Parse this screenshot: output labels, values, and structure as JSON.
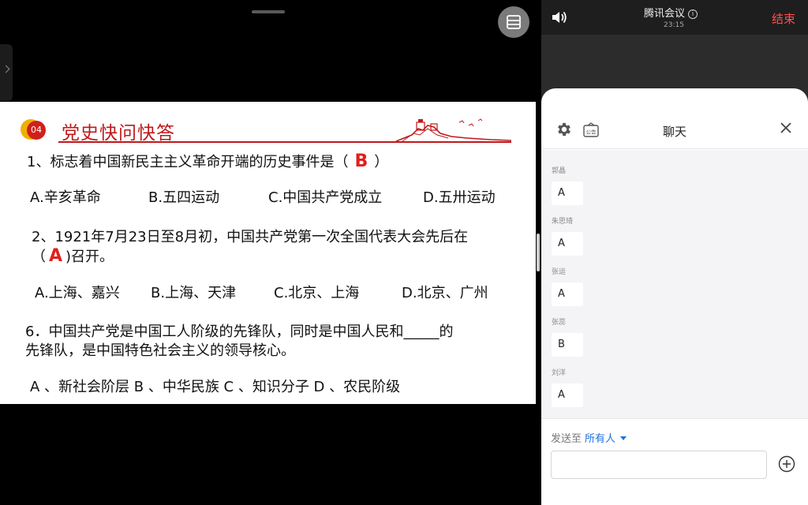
{
  "slide": {
    "badge_number": "04",
    "title": "党史快问快答",
    "q1": {
      "text": "1、标志着中国新民主主义革命开端的历史事件是（",
      "answer": "B",
      "close": "）"
    },
    "q1_options": [
      "A.辛亥革命",
      "B.五四运动",
      "C.中国共产党成立",
      "D.五卅运动"
    ],
    "q2": {
      "line1": "2、1921年7月23日至8月初，中国共产党第一次全国代表大会先后在",
      "open": "（",
      "answer": "A",
      "line2_end": ")召开。"
    },
    "q2_options": [
      "A.上海、嘉兴",
      "B.上海、天津",
      "C.北京、上海",
      "D.北京、广州"
    ],
    "q3": {
      "line1": "6．中国共产党是中国工人阶级的先锋队，同时是中国人民和_____的",
      "line2": "先锋队，是中国特色社会主义的领导核心。"
    },
    "q3_options": "A 、新社会阶层 B 、中华民族 C 、知识分子 D 、农民阶级"
  },
  "meeting": {
    "app_title": "腾讯会议",
    "time": "23:15",
    "end_label": "结束"
  },
  "chat": {
    "title": "聊天",
    "messages": [
      {
        "sender": "郭晶",
        "text": "A"
      },
      {
        "sender": "朱思琦",
        "text": "A"
      },
      {
        "sender": "张运",
        "text": "A"
      },
      {
        "sender": "张蕊",
        "text": "B"
      },
      {
        "sender": "刘洋",
        "text": "A"
      }
    ],
    "send_to_label": "发送至",
    "send_to_target": "所有人",
    "input_placeholder": "",
    "notice_icon_text": "公告"
  },
  "colors": {
    "accent_red": "#c0181b",
    "end_red": "#ff4d4f",
    "link_blue": "#1f6fdc"
  }
}
